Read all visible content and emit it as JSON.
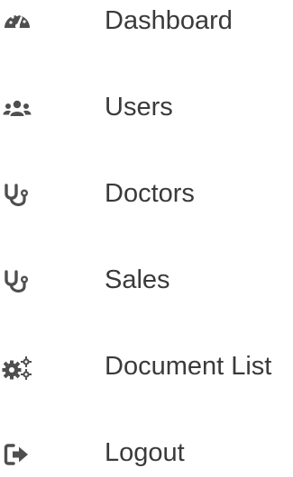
{
  "menu": {
    "icon_color": "#4f4f4f",
    "text_color": "#3a3a3a",
    "items": [
      {
        "label": "Dashboard",
        "icon": "tachometer-icon"
      },
      {
        "label": "Users",
        "icon": "users-icon"
      },
      {
        "label": "Doctors",
        "icon": "stethoscope-icon"
      },
      {
        "label": "Sales",
        "icon": "stethoscope-icon"
      },
      {
        "label": "Document List",
        "icon": "cogs-icon"
      },
      {
        "label": "Logout",
        "icon": "sign-out-icon"
      }
    ]
  }
}
